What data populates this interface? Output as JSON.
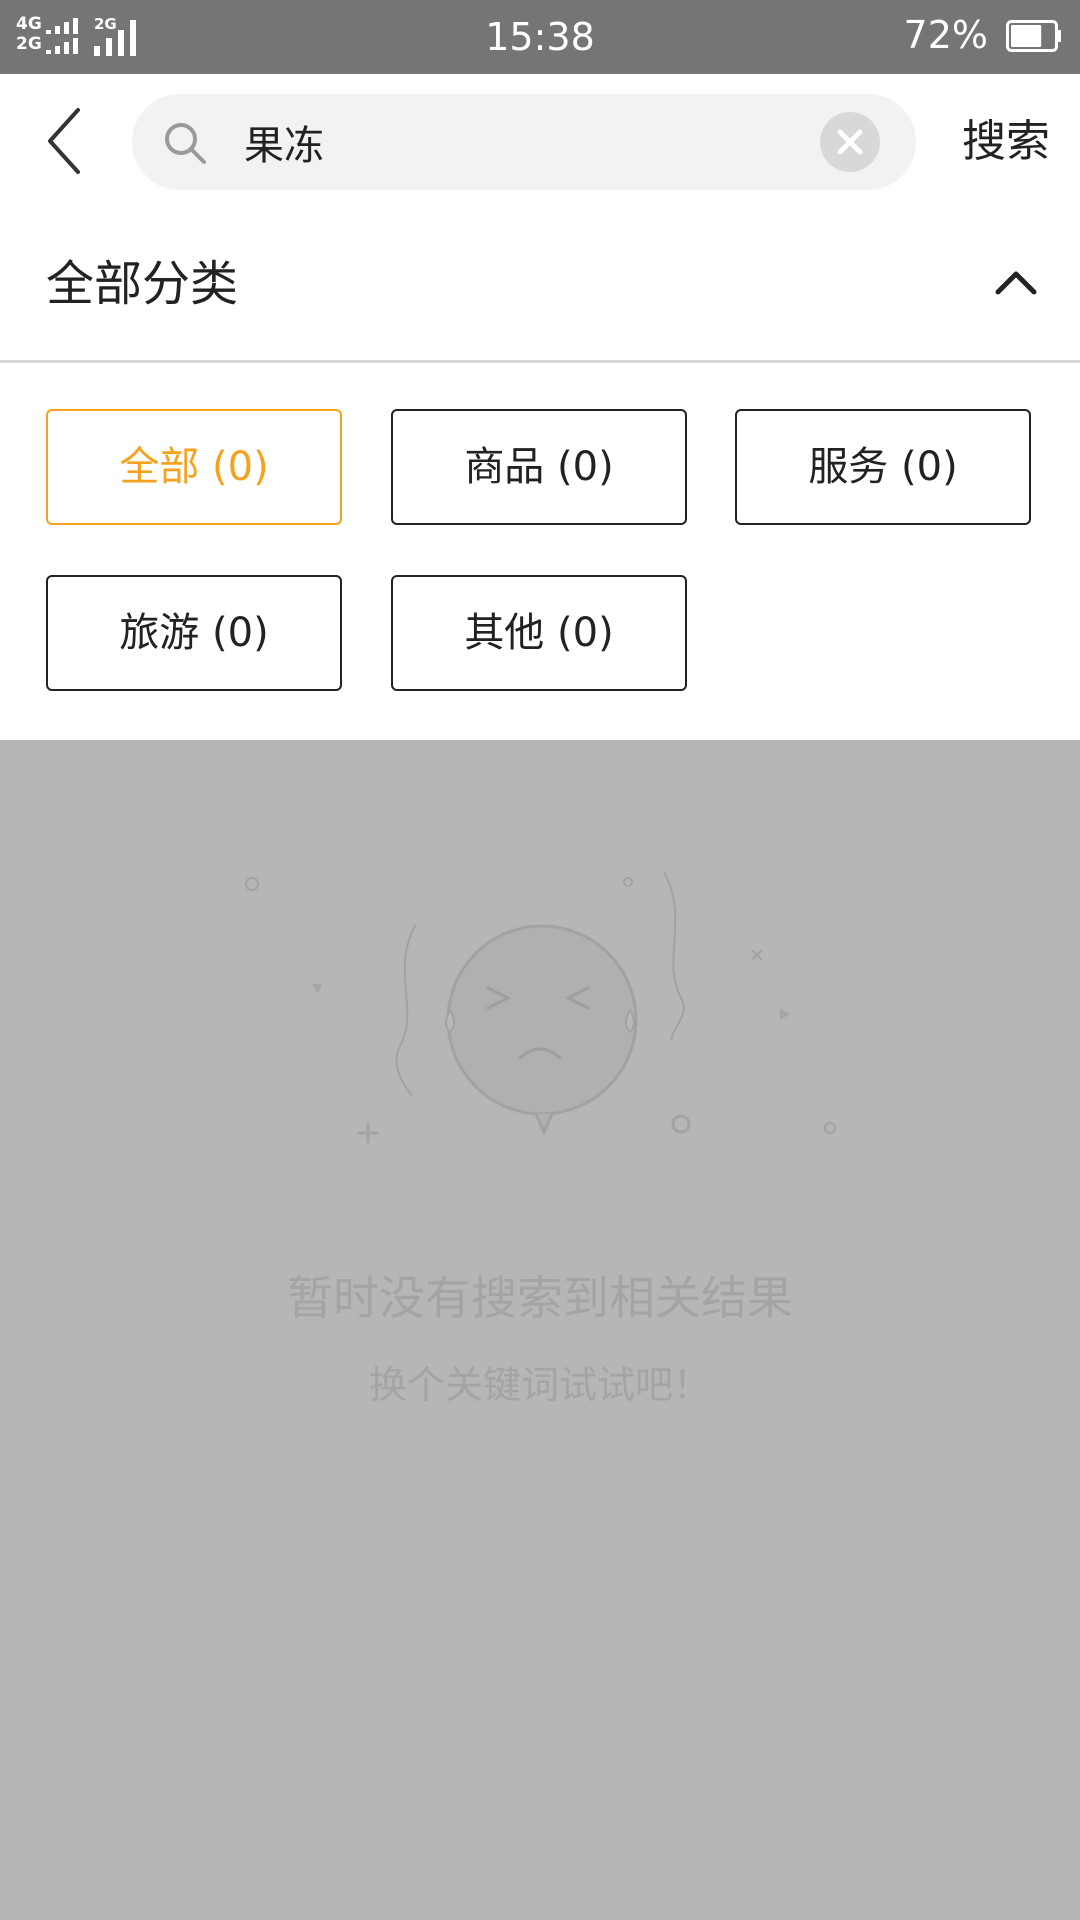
{
  "status_bar": {
    "network_top": "4G",
    "network_bottom": "2G",
    "network_right": "2G",
    "time": "15:38",
    "battery_percent": "72%",
    "battery_level": 0.72
  },
  "search": {
    "query": "果冻",
    "button_label": "搜索"
  },
  "category": {
    "title": "全部分类"
  },
  "filters": [
    {
      "label": "全部 (0)",
      "selected": true
    },
    {
      "label": "商品 (0)",
      "selected": false
    },
    {
      "label": "服务 (0)",
      "selected": false
    },
    {
      "label": "旅游 (0)",
      "selected": false
    },
    {
      "label": "其他 (0)",
      "selected": false
    }
  ],
  "empty_state": {
    "title": "暂时没有搜索到相关结果",
    "subtitle": "换个关键词试试吧！"
  },
  "colors": {
    "accent": "#f5a21e",
    "status_bar": "#757575",
    "overlay": "#b6b6b6"
  }
}
